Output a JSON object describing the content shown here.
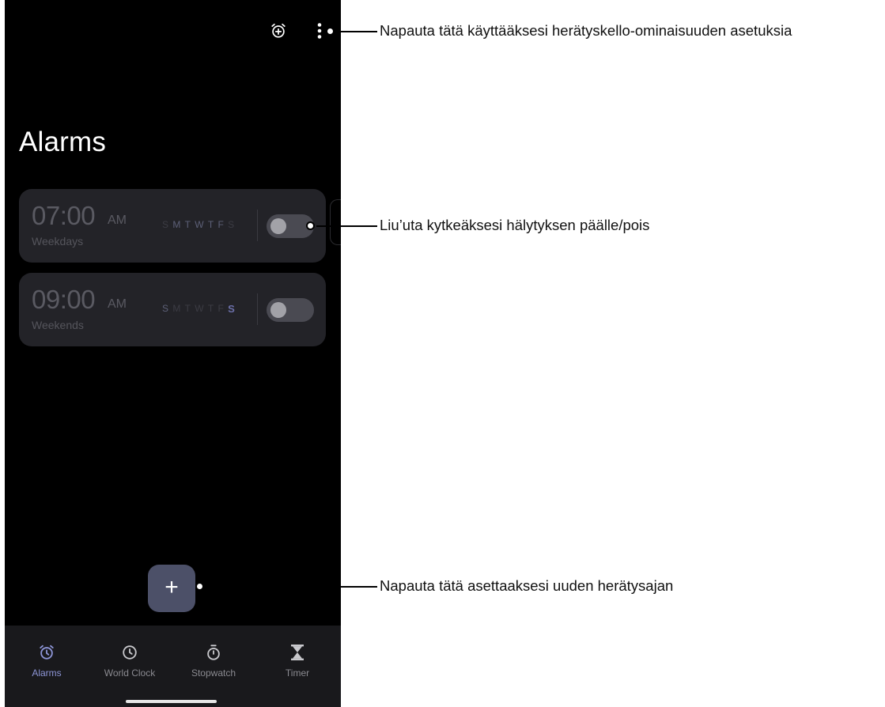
{
  "app": {
    "title": "Alarms",
    "topbar": {
      "add_alarm_icon": "alarm-add-icon",
      "more_icon": "more-vert-icon"
    }
  },
  "alarms": [
    {
      "time": "07:00",
      "ampm": "AM",
      "label": "Weekdays",
      "days": [
        "S",
        "M",
        "T",
        "W",
        "T",
        "F",
        "S"
      ],
      "enabled": false
    },
    {
      "time": "09:00",
      "ampm": "AM",
      "label": "Weekends",
      "days": [
        "S",
        "M",
        "T",
        "W",
        "T",
        "F",
        "S"
      ],
      "enabled": false
    }
  ],
  "fab": {
    "label": "+"
  },
  "bottom_nav": {
    "items": [
      {
        "label": "Alarms",
        "icon": "alarm-icon",
        "active": true
      },
      {
        "label": "World Clock",
        "icon": "clock-icon",
        "active": false
      },
      {
        "label": "Stopwatch",
        "icon": "stopwatch-icon",
        "active": false
      },
      {
        "label": "Timer",
        "icon": "hourglass-icon",
        "active": false
      }
    ]
  },
  "callouts": {
    "settings": "Napauta tätä käyttääksesi herätyskello-ominaisuuden asetuksia",
    "toggle": "Liu’uta kytkeäksesi hälytyksen päälle/pois",
    "new_alarm": "Napauta tätä asettaaksesi uuden herätysajan"
  },
  "colors": {
    "background": "#000000",
    "card": "#232328",
    "accent": "#8d95d6",
    "fab": "#4c5068",
    "nav_bar": "#19191c"
  }
}
